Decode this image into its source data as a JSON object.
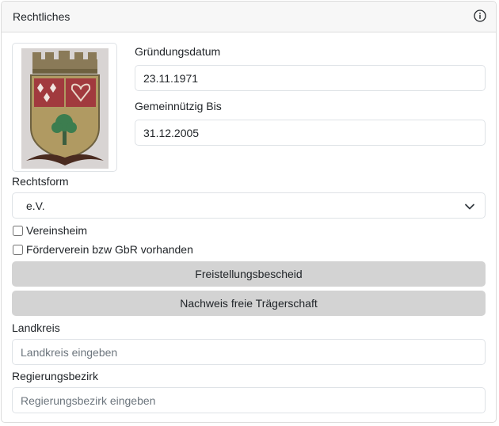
{
  "header": {
    "title": "Rechtliches",
    "info_icon": "info-circle-icon"
  },
  "logo": {
    "alt": "Wappen",
    "colors": {
      "shield_gold": "#b09a62",
      "red": "#a13a3e",
      "tree_green": "#3c7d4f"
    }
  },
  "fields": {
    "gruendungsdatum": {
      "label": "Gründungsdatum",
      "value": "23.11.1971"
    },
    "gemeinnuetzig_bis": {
      "label": "Gemeinnützig Bis",
      "value": "31.12.2005"
    },
    "rechtsform": {
      "label": "Rechtsform",
      "value": "e.V."
    },
    "landkreis": {
      "label": "Landkreis",
      "placeholder": "Landkreis eingeben"
    },
    "regierungsbezirk": {
      "label": "Regierungsbezirk",
      "placeholder": "Regierungsbezirk eingeben"
    }
  },
  "checkboxes": {
    "vereinsheim": {
      "label": "Vereinsheim",
      "checked": false
    },
    "foerderverein": {
      "label": "Förderverein bzw GbR vorhanden",
      "checked": false
    }
  },
  "buttons": {
    "freistellung": "Freistellungsbescheid",
    "traegerschaft": "Nachweis freie Trägerschaft"
  }
}
